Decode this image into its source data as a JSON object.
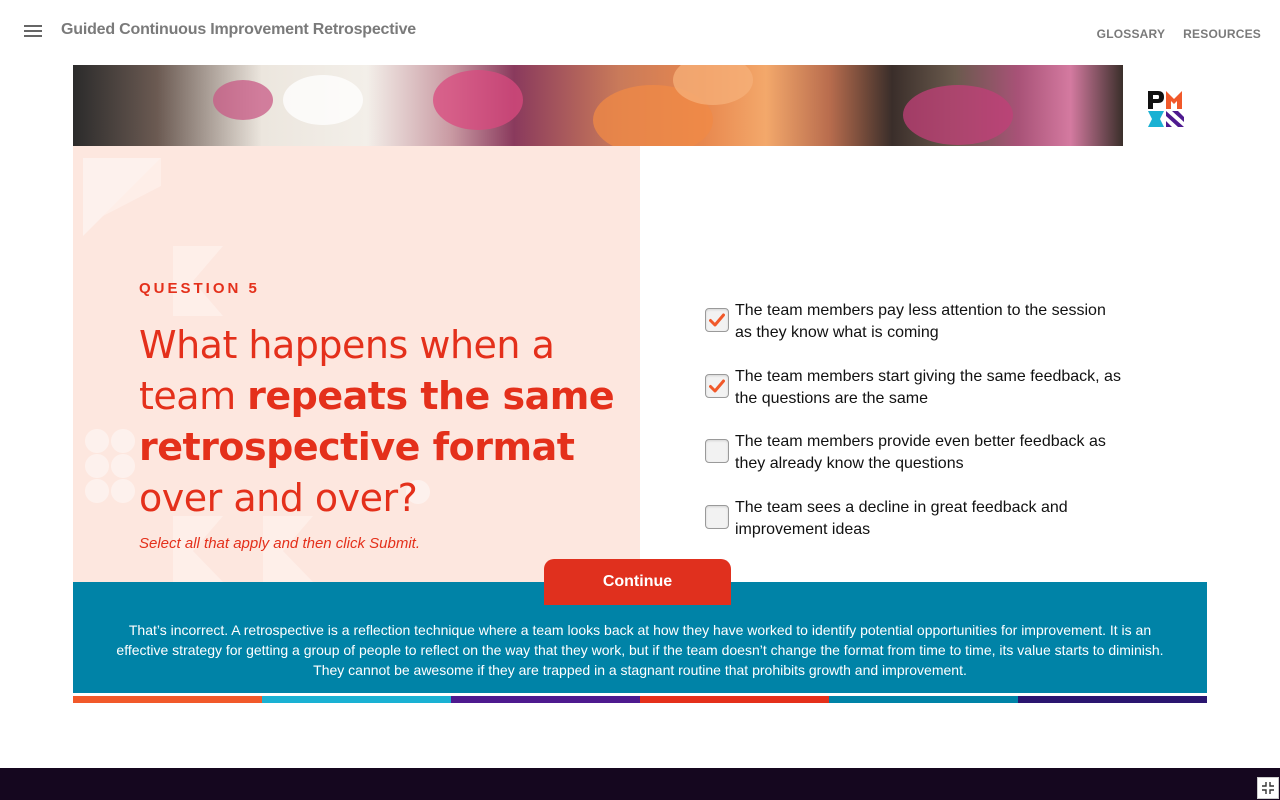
{
  "header": {
    "title": "Guided Continuous Improvement Retrospective",
    "links": [
      "GLOSSARY",
      "RESOURCES"
    ]
  },
  "question": {
    "label": "QUESTION 5",
    "text_part1": "What happens when a team ",
    "text_bold": "repeats the same retrospective format",
    "text_part2": " over and over?",
    "instruction": "Select all that apply and then click Submit."
  },
  "options": [
    {
      "text": "The team members pay less attention to the session as they know what is coming",
      "checked": true
    },
    {
      "text": "The team members start giving the same feedback, as the questions are the same",
      "checked": true
    },
    {
      "text": "The team members provide even better feedback as they already know the questions",
      "checked": false
    },
    {
      "text": "The team sees a decline in great feedback and improvement ideas",
      "checked": false
    }
  ],
  "continue_label": "Continue",
  "feedback": "That’s incorrect. A retrospective is a reflection technique where a team looks back at how they have worked to identify potential opportunities for improvement. It is an effective strategy for getting a group of people to reflect on the way that they work, but if the team doesn’t change the format from time to time, its value starts to diminish. They cannot be awesome if they are trapped in a stagnant routine that prohibits growth and improvement.",
  "colors": {
    "accent": "#e4301b",
    "feedback_bg": "#0083a7",
    "panel_bg": "#fde7df",
    "footer_bg": "#15071f",
    "stripes": [
      "#f1592a",
      "#1ab1d3",
      "#4e1a8f",
      "#e4301b",
      "#0083a7",
      "#2a1570"
    ]
  },
  "icons": {
    "menu": "hamburger-icon",
    "logo": "pmi-logo",
    "checkmark": "checkmark-icon",
    "fullscreen": "exit-fullscreen-icon"
  }
}
